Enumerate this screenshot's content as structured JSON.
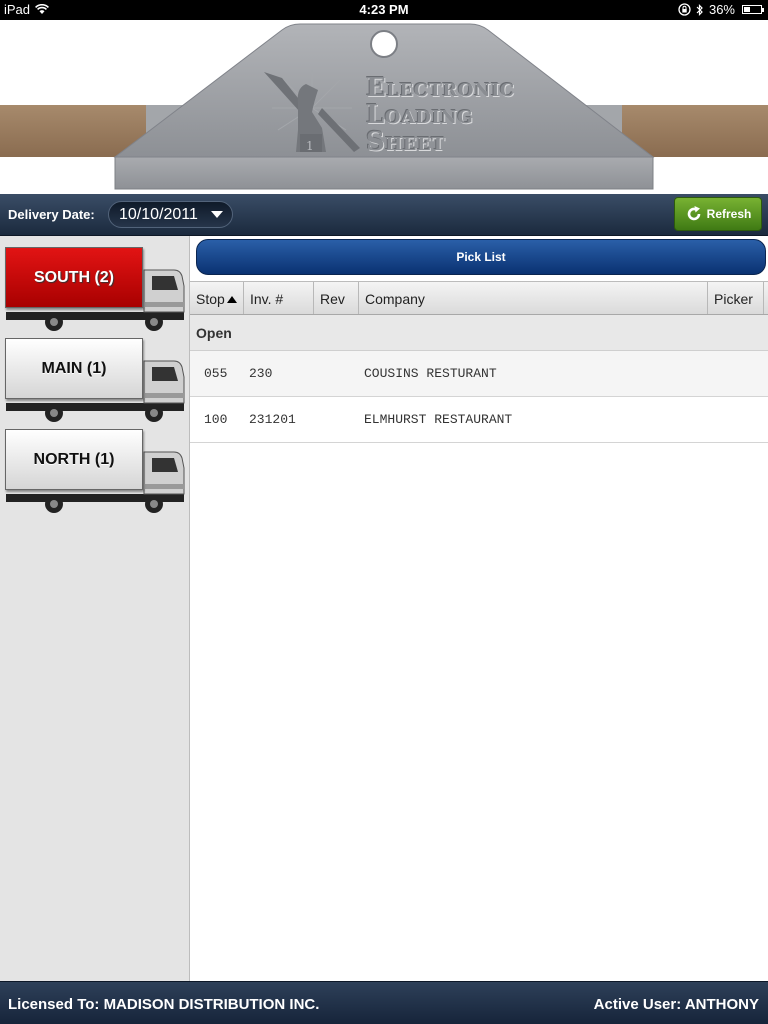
{
  "status_bar": {
    "device": "iPad",
    "time": "4:23 PM",
    "battery": "36%",
    "battery_level": 0.36
  },
  "banner": {
    "logo_lines": [
      "Electronic",
      "Loading",
      "Sheet"
    ]
  },
  "delivery": {
    "label": "Delivery Date:",
    "date": "10/10/2011",
    "refresh_label": "Refresh"
  },
  "routes": [
    {
      "label": "SOUTH (2)",
      "selected": true
    },
    {
      "label": "MAIN (1)",
      "selected": false
    },
    {
      "label": "NORTH (1)",
      "selected": false
    }
  ],
  "pick_list": {
    "title": "Pick List",
    "columns": [
      "Stop",
      "Inv. #",
      "Rev",
      "Company",
      "Picker"
    ],
    "group": "Open",
    "rows": [
      {
        "stop": "055",
        "invoice": "230",
        "rev": "",
        "company": "COUSINS RESTURANT",
        "picker": ""
      },
      {
        "stop": "100",
        "invoice": "231201",
        "rev": "",
        "company": "ELMHURST RESTAURANT",
        "picker": ""
      }
    ]
  },
  "footer": {
    "licensed": "Licensed To: MADISON DISTRIBUTION INC.",
    "active_user": "Active User: ANTHONY"
  }
}
